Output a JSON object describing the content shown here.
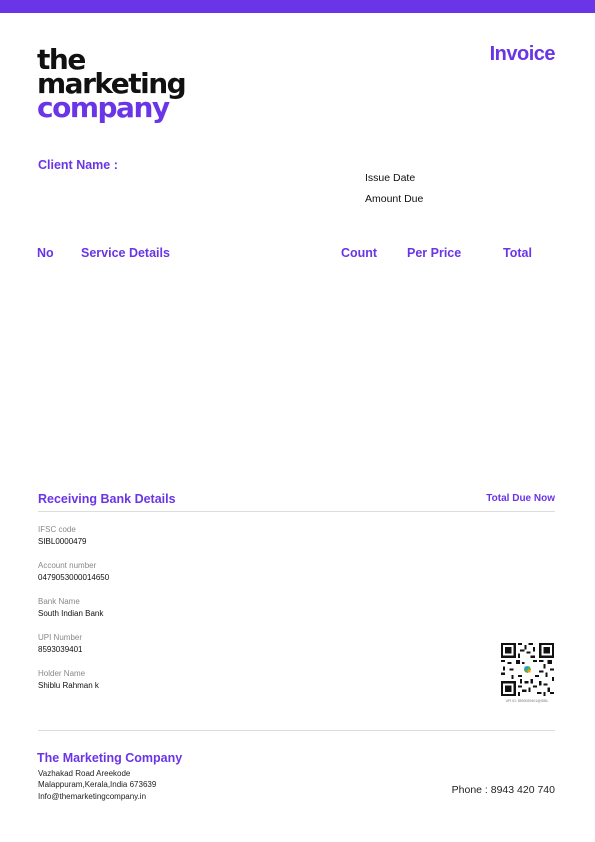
{
  "brand": {
    "accent": "#6a35e6",
    "text": "#111111"
  },
  "logo": {
    "line1": "the",
    "line2": "marketing",
    "line3": "company"
  },
  "invoice": {
    "title": "Invoice",
    "client_label": "Client Name :",
    "issue_date_label": "Issue Date",
    "amount_due_label": "Amount Due"
  },
  "table": {
    "headers": [
      "No",
      "Service Details",
      "Count",
      "Per Price",
      "Total"
    ]
  },
  "bank": {
    "title": "Receiving Bank Details",
    "total_due_label": "Total Due Now",
    "fields": [
      {
        "label": "IFSC code",
        "value": "SIBL0000479"
      },
      {
        "label": "Account number",
        "value": "0479053000014650"
      },
      {
        "label": "Bank Name",
        "value": "South Indian Bank"
      },
      {
        "label": "UPI Number",
        "value": "8593039401"
      },
      {
        "label": "Holder Name",
        "value": "Shiblu Rahman k"
      }
    ],
    "qr_icon": "qr-code",
    "qr_caption": "UPI ID: 8593039401@SIBL"
  },
  "footer": {
    "company": "The Marketing Company",
    "address_lines": [
      "Vazhakad Road Areekode",
      "Malappuram,Kerala,India 673639",
      "Info@themarketingcompany.in"
    ],
    "phone": "Phone : 8943 420 740"
  }
}
